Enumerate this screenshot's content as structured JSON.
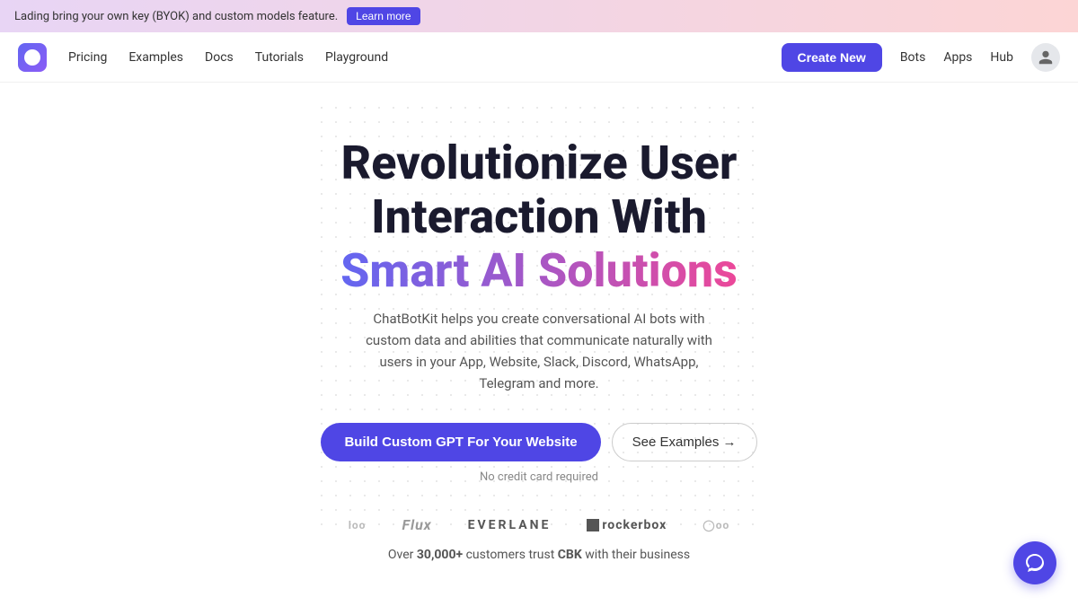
{
  "announcement": {
    "text": "Lading bring your own key (BYOK) and custom models feature.",
    "learn_more": "Learn more"
  },
  "nav": {
    "logo_alt": "ChatBotKit logo",
    "links": [
      {
        "label": "Pricing",
        "href": "#"
      },
      {
        "label": "Examples",
        "href": "#"
      },
      {
        "label": "Docs",
        "href": "#"
      },
      {
        "label": "Tutorials",
        "href": "#"
      },
      {
        "label": "Playground",
        "href": "#"
      }
    ],
    "right_links": [
      {
        "label": "Bots",
        "href": "#"
      },
      {
        "label": "Apps",
        "href": "#"
      },
      {
        "label": "Hub",
        "href": "#"
      }
    ],
    "cta_label": "Create New"
  },
  "hero": {
    "title_line1": "Revolutionize User",
    "title_line2": "Interaction With",
    "title_gradient": "Smart AI Solutions",
    "subtitle": "ChatBotKit helps you create conversational AI bots with custom data and abilities that communicate naturally with users in your App, Website, Slack, Discord, WhatsApp, Telegram and more.",
    "btn_primary": "Build Custom GPT For Your Website",
    "btn_secondary": "See Examples →",
    "no_credit_card": "No credit card required",
    "trust_text_pre": "Over ",
    "trust_count": "30,000+",
    "trust_text_mid": " customers trust ",
    "trust_brand": "CBK",
    "trust_text_post": " with their business"
  },
  "logos": [
    {
      "label": "loo",
      "class": "small"
    },
    {
      "label": "Flux",
      "class": "flux"
    },
    {
      "label": "EVERLANE",
      "class": "everlane"
    },
    {
      "label": "⬛ rockerbox",
      "class": "rockerbox"
    },
    {
      "label": "◯oo",
      "class": "small"
    }
  ],
  "colors": {
    "primary": "#4f46e5",
    "gradient_start": "#6366f1",
    "gradient_end": "#ec4899"
  }
}
